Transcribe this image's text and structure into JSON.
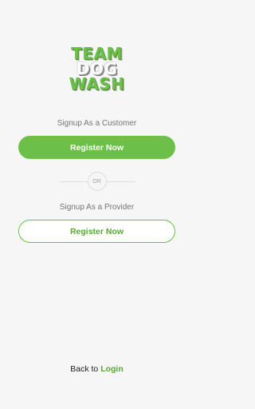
{
  "logo": {
    "line1": "TEAM",
    "line2": "DOG",
    "line3": "WASH"
  },
  "customer": {
    "caption": "Signup As a Customer",
    "button_label": "Register Now"
  },
  "divider": {
    "label": "OR"
  },
  "provider": {
    "caption": "Signup As a Provider",
    "button_label": "Register Now"
  },
  "footer": {
    "prefix": "Back to",
    "link_label": "Login"
  },
  "colors": {
    "accent": "#6cc04a",
    "background": "#f6f6f6"
  }
}
